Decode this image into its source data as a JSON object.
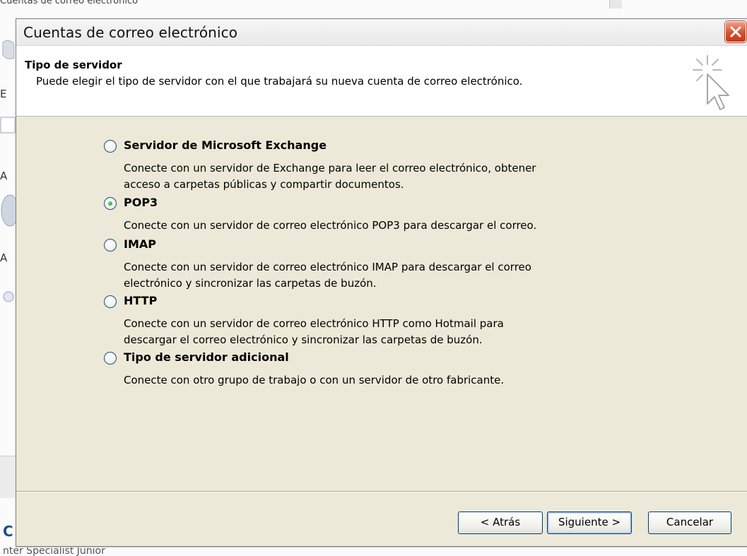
{
  "background": {
    "top_text": "Cuentas de correo electrónico",
    "left_fragments": [
      "E",
      "A",
      "A"
    ],
    "bottom_fragment": "C",
    "bottom_text": "nter Specialist Junior"
  },
  "dialog": {
    "title": "Cuentas de correo electrónico",
    "close_icon": "close-icon",
    "header": {
      "title": "Tipo de servidor",
      "subtitle": "Puede elegir el tipo de servidor con el que trabajará su nueva cuenta de correo electrónico.",
      "icon": "wizard-cursor-icon"
    },
    "options": [
      {
        "label": "Servidor de Microsoft Exchange",
        "description": "Conecte con un servidor de Exchange para leer el correo electrónico, obtener\nacceso a carpetas públicas y compartir documentos.",
        "selected": false
      },
      {
        "label": "POP3",
        "description": "Conecte con un servidor de correo electrónico POP3 para descargar el correo.",
        "selected": true
      },
      {
        "label": "IMAP",
        "description": "Conecte con un servidor de correo electrónico IMAP para descargar el correo\nelectrónico y sincronizar las carpetas de buzón.",
        "selected": false
      },
      {
        "label": "HTTP",
        "description": "Conecte con un servidor de correo electrónico HTTP como Hotmail para\ndescargar el correo electrónico y sincronizar las carpetas de buzón.",
        "selected": false
      },
      {
        "label": "Tipo de servidor adicional",
        "description": "Conecte con otro grupo de trabajo o con un servidor de otro fabricante.",
        "selected": false
      }
    ],
    "buttons": {
      "back": "< Atrás",
      "next": "Siguiente >",
      "cancel": "Cancelar"
    }
  },
  "colors": {
    "dialog_bg": "#ece9d8",
    "header_bg": "#ffffff",
    "close_button": "#d5512e",
    "button_border": "#003c74",
    "radio_dot": "#21a121"
  }
}
